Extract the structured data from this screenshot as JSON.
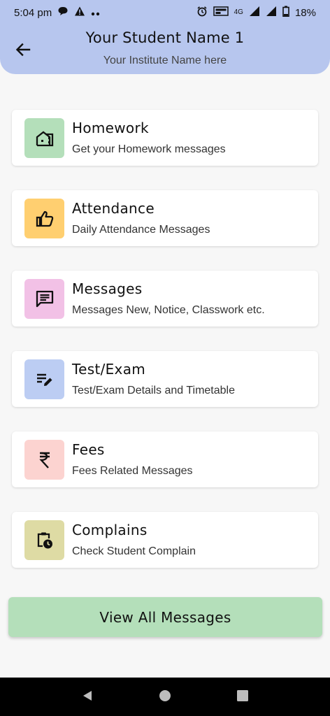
{
  "status": {
    "time": "5:04 pm",
    "battery": "18%",
    "network": "4G",
    "icons_left": [
      "chat-icon",
      "alert-icon",
      "more-dots-icon"
    ],
    "icons_right": [
      "alarm-icon",
      "volte-icon",
      "network-4g-icon",
      "signal-icon",
      "signal-icon",
      "battery-icon"
    ]
  },
  "header": {
    "title": "Your Student Name 1",
    "subtitle": "Your Institute Name here",
    "background": "#b7c6ee"
  },
  "cards": [
    {
      "title": "Homework",
      "subtitle": "Get your Homework messages",
      "icon": "building-icon",
      "color": "#b4dfba"
    },
    {
      "title": "Attendance",
      "subtitle": "Daily Attendance Messages",
      "icon": "thumb-up-icon",
      "color": "#ffcf70"
    },
    {
      "title": "Messages",
      "subtitle": "Messages New, Notice, Classwork etc.",
      "icon": "message-icon",
      "color": "#f2c1e6"
    },
    {
      "title": "Test/Exam",
      "subtitle": "Test/Exam Details and Timetable",
      "icon": "edit-list-icon",
      "color": "#bccdf3"
    },
    {
      "title": "Fees",
      "subtitle": "Fees Related Messages",
      "icon": "rupee-icon",
      "color": "#fcd3d0"
    },
    {
      "title": "Complains",
      "subtitle": "Check Student Complain",
      "icon": "clipboard-clock-icon",
      "color": "#dedba4"
    }
  ],
  "view_all_label": "View All Messages",
  "view_all_color": "#b4dfba",
  "nav": [
    "back-triangle-icon",
    "home-circle-icon",
    "recents-square-icon"
  ]
}
